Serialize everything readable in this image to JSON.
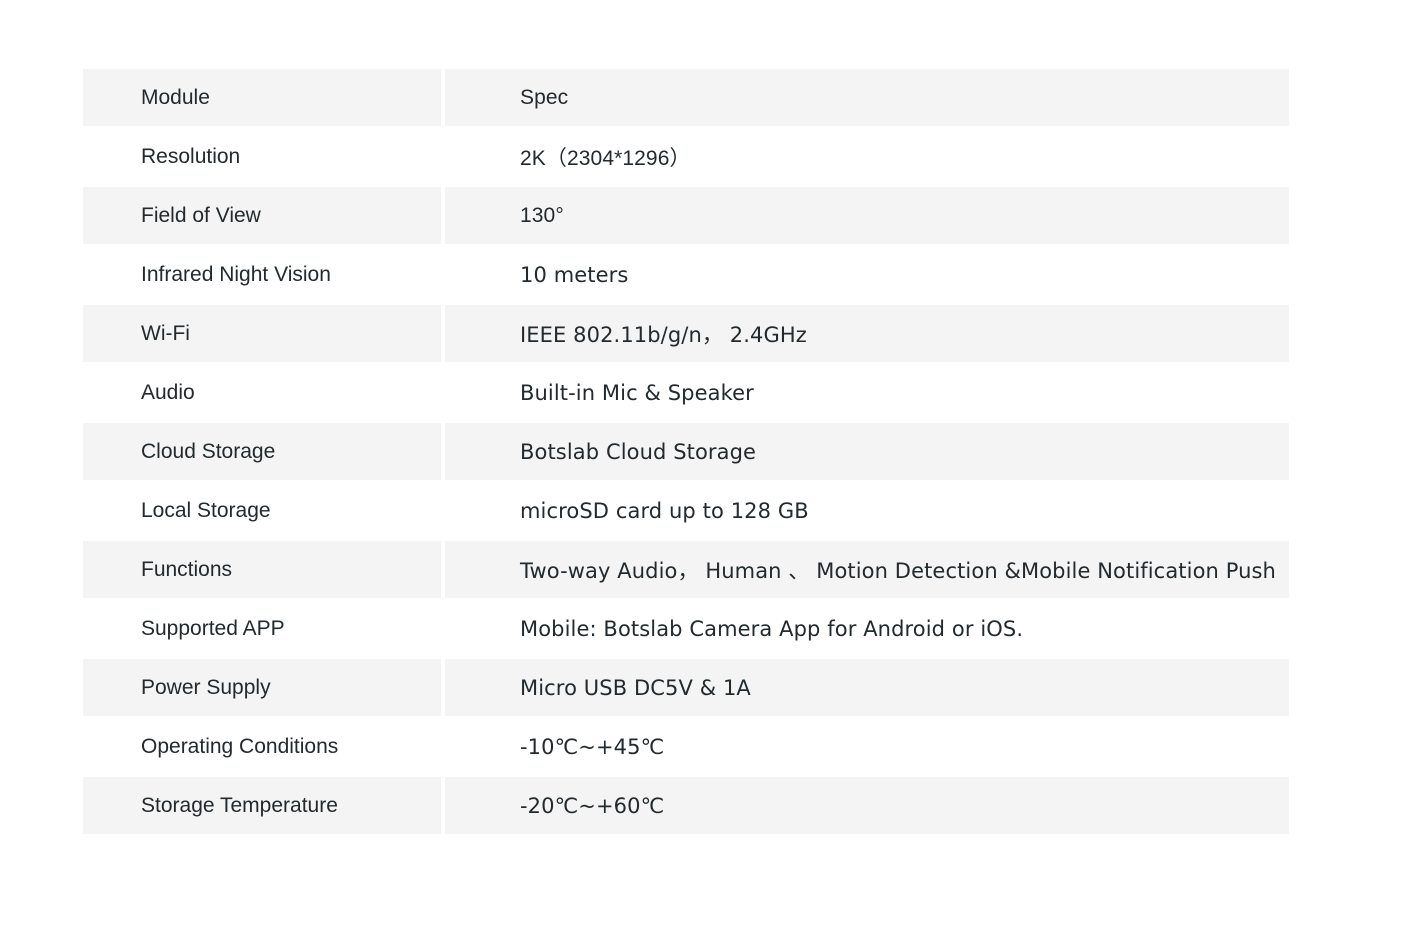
{
  "table": {
    "header": {
      "label": "Module",
      "value": "Spec"
    },
    "rows": [
      {
        "label": "Resolution",
        "value": "2K（2304*1296）"
      },
      {
        "label": "Field of View",
        "value": "130°"
      },
      {
        "label": "Infrared Night Vision",
        "value": "10 meters"
      },
      {
        "label": "Wi-Fi",
        "value": "IEEE 802.11b/g/n， 2.4GHz"
      },
      {
        "label": "Audio",
        "value": "Built-in Mic & Speaker"
      },
      {
        "label": "Cloud Storage",
        "value": "Botslab Cloud Storage"
      },
      {
        "label": "Local Storage",
        "value": "microSD card up to 128 GB"
      },
      {
        "label": "Functions",
        "value": "Two-way Audio， Human 、 Motion Detection &Mobile Notification Push"
      },
      {
        "label": "Supported APP",
        "value": "Mobile: Botslab Camera App for Android or iOS."
      },
      {
        "label": "Power Supply",
        "value": "Micro USB DC5V & 1A"
      },
      {
        "label": "Operating Conditions",
        "value": "-10℃~+45℃"
      },
      {
        "label": "Storage Temperature",
        "value": "-20℃~+60℃"
      }
    ]
  },
  "colors": {
    "row_shade": "#f4f4f4",
    "text": "#222a2e",
    "background": "#ffffff"
  }
}
